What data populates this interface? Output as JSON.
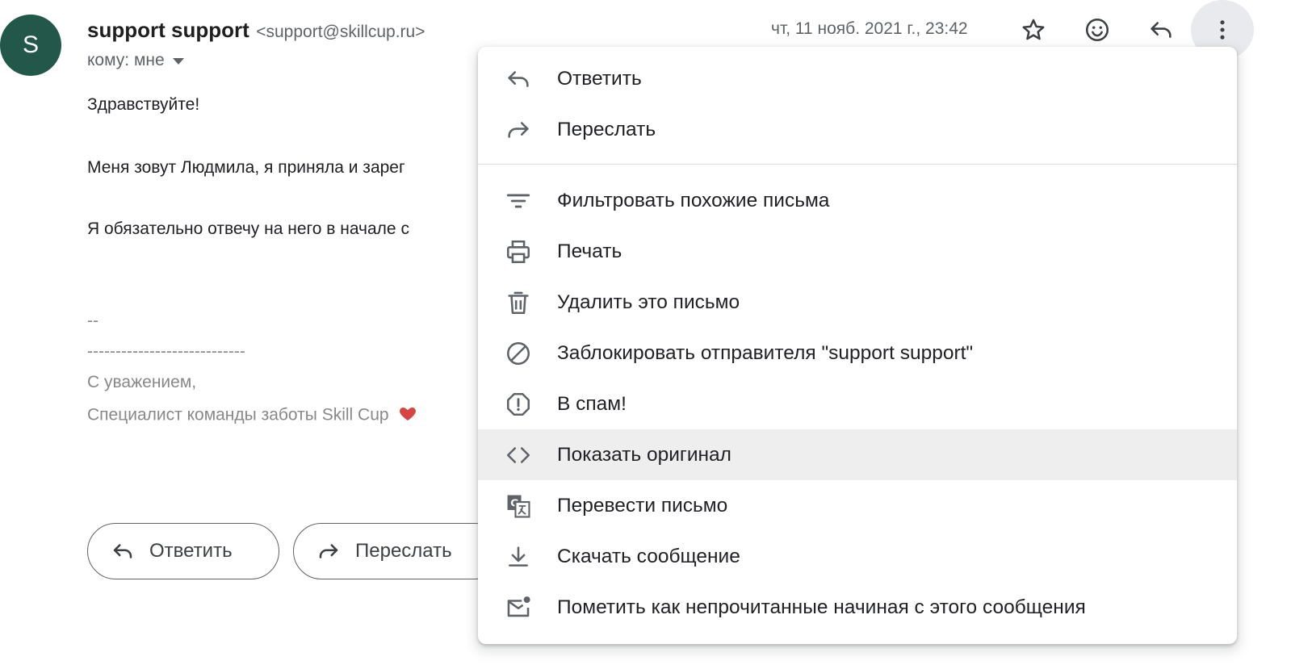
{
  "sender": {
    "avatar_letter": "S",
    "name": "support support",
    "email": "<support@skillcup.ru>",
    "to_label": "кому: мне",
    "date": "чт, 11 нояб. 2021 г., 23:42"
  },
  "header_icons": [
    "star-icon",
    "emoji-icon",
    "reply-icon",
    "more-vert-icon"
  ],
  "body": {
    "greeting": "Здравствуйте!",
    "line1": "Меня зовут Людмила, я приняла и зарег",
    "line2": "Я обязательно отвечу на него в начале с",
    "sig_dashes_short": "--",
    "sig_dashes_long": "----------------------------",
    "sig_regards": "С уважением,",
    "sig_title": "Специалист команды заботы Skill Cup",
    "heart_color": "#d64541"
  },
  "actions": {
    "reply_label": "Ответить",
    "forward_label": "Переслать"
  },
  "menu": {
    "group1": [
      {
        "icon": "reply-icon",
        "label": "Ответить"
      },
      {
        "icon": "forward-icon",
        "label": "Переслать"
      }
    ],
    "group2": [
      {
        "icon": "filter-icon",
        "label": "Фильтровать похожие письма"
      },
      {
        "icon": "print-icon",
        "label": "Печать"
      },
      {
        "icon": "trash-icon",
        "label": "Удалить это письмо"
      },
      {
        "icon": "block-icon",
        "label": "Заблокировать отправителя \"support support\""
      },
      {
        "icon": "spam-icon",
        "label": "В спам!"
      },
      {
        "icon": "code-icon",
        "label": "Показать оригинал"
      },
      {
        "icon": "translate-icon",
        "label": "Перевести письмо"
      },
      {
        "icon": "download-icon",
        "label": "Скачать сообщение"
      },
      {
        "icon": "mark-unread-icon",
        "label": "Пометить как непрочитанные начиная с этого сообщения"
      }
    ],
    "hovered_item": "Показать оригинал"
  },
  "colors": {
    "avatar_bg": "#22574a",
    "icon": "#5f6368",
    "hover_bg": "#eeeeee"
  }
}
